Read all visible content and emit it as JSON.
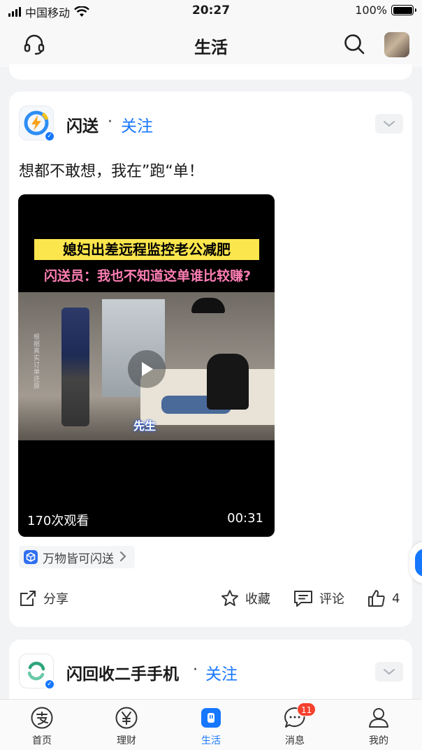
{
  "status_bar": {
    "carrier": "中国移动",
    "time": "20:27",
    "battery": "100%"
  },
  "header": {
    "title": "生活"
  },
  "post": {
    "account_name": "闪送",
    "separator": "·",
    "follow_label": "关注",
    "text": "想都不敢想，我在”跑“单！",
    "video": {
      "banner_title": "媳妇出差远程监控老公减肥",
      "banner_subtitle": "闪送员：我也不知道这单谁比较赚?",
      "side_caption": "根据真实订单还原",
      "caption": "先生",
      "views": "170次观看",
      "duration": "00:31"
    },
    "source_tag": "万物皆可闪送",
    "actions": {
      "share": "分享",
      "favorite": "收藏",
      "comment": "评论",
      "like_count": "4"
    }
  },
  "next_post": {
    "account_name": "闪回收二手手机",
    "separator": "·",
    "follow_label": "关注"
  },
  "tabbar": {
    "items": [
      {
        "label": "首页",
        "icon": "alipay-icon"
      },
      {
        "label": "理财",
        "icon": "yuan-icon"
      },
      {
        "label": "生活",
        "icon": "life-icon",
        "active": true
      },
      {
        "label": "消息",
        "icon": "message-icon",
        "badge": "11"
      },
      {
        "label": "我的",
        "icon": "profile-icon"
      }
    ]
  },
  "colors": {
    "accent": "#1677ff",
    "badge": "#f5412d",
    "banner_yellow": "#fce64d",
    "banner_pink": "#ff7eb3"
  }
}
